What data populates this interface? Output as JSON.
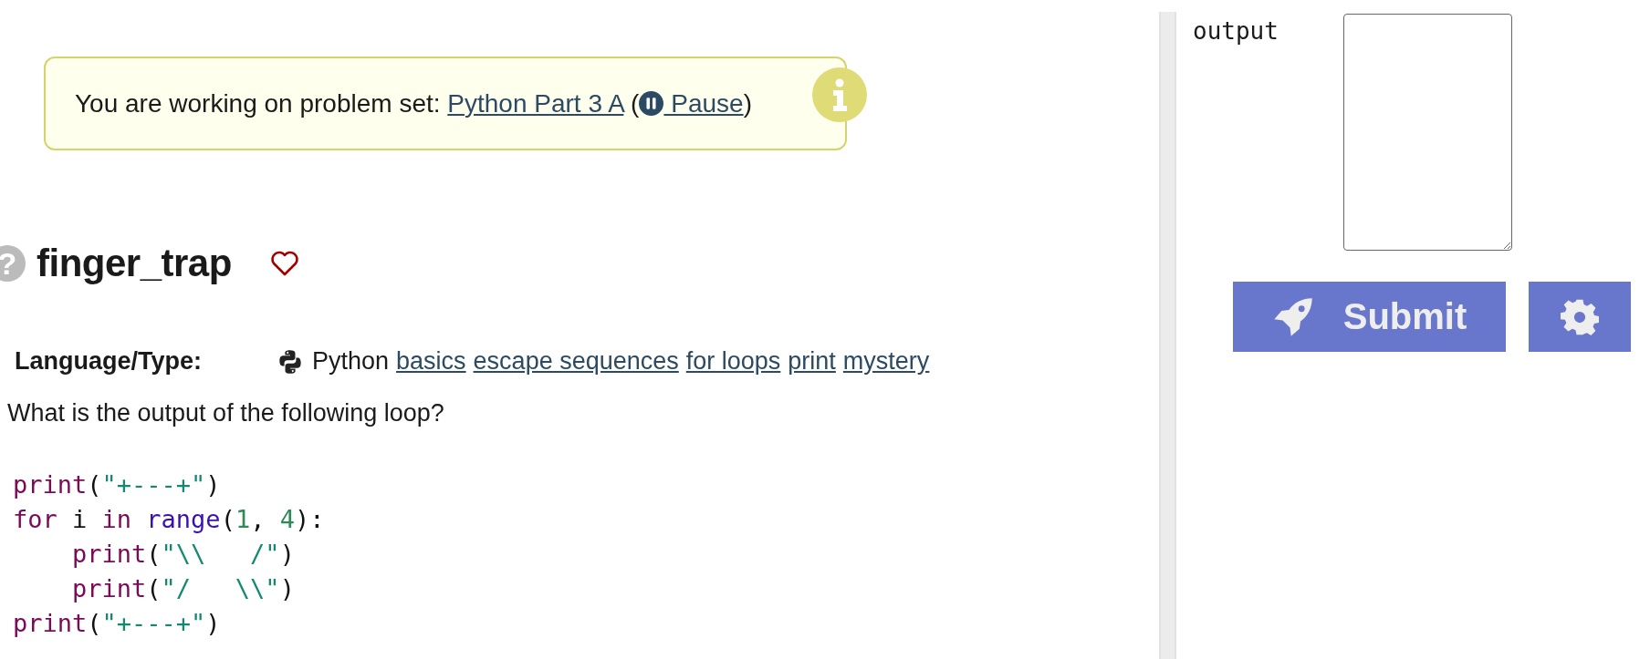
{
  "banner": {
    "prefix": "You are working on problem set: ",
    "set_link": "Python Part 3 A",
    "open_paren": " (",
    "pause_link": " Pause",
    "close_paren": ")"
  },
  "problem": {
    "help_icon": "?",
    "title": "finger_trap",
    "favorite": false
  },
  "language": {
    "label": "Language/Type:",
    "name": "Python",
    "tags": [
      "basics",
      "escape sequences",
      "for loops",
      "print",
      "mystery"
    ]
  },
  "question": "What is the output of the following loop?",
  "code": [
    {
      "tokens": [
        {
          "kind": "keyword",
          "text": "print"
        },
        {
          "kind": "plain",
          "text": "("
        },
        {
          "kind": "string",
          "text": "\"+---+\""
        },
        {
          "kind": "plain",
          "text": ")"
        }
      ]
    },
    {
      "tokens": [
        {
          "kind": "keyword",
          "text": "for"
        },
        {
          "kind": "plain",
          "text": " i "
        },
        {
          "kind": "keyword",
          "text": "in"
        },
        {
          "kind": "builtin",
          "text": " range"
        },
        {
          "kind": "plain",
          "text": "("
        },
        {
          "kind": "number",
          "text": "1"
        },
        {
          "kind": "plain",
          "text": ", "
        },
        {
          "kind": "number",
          "text": "4"
        },
        {
          "kind": "plain",
          "text": "):"
        }
      ]
    },
    {
      "tokens": [
        {
          "kind": "keyword",
          "text": "    print"
        },
        {
          "kind": "plain",
          "text": "("
        },
        {
          "kind": "string",
          "text": "\"\\\\   /\""
        },
        {
          "kind": "plain",
          "text": ")"
        }
      ]
    },
    {
      "tokens": [
        {
          "kind": "keyword",
          "text": "    print"
        },
        {
          "kind": "plain",
          "text": "("
        },
        {
          "kind": "string",
          "text": "\"/   \\\\\""
        },
        {
          "kind": "plain",
          "text": ")"
        }
      ]
    },
    {
      "tokens": [
        {
          "kind": "keyword",
          "text": "print"
        },
        {
          "kind": "plain",
          "text": "("
        },
        {
          "kind": "string",
          "text": "\"+---+\""
        },
        {
          "kind": "plain",
          "text": ")"
        }
      ]
    }
  ],
  "answer": {
    "label": "output",
    "submit": "Submit"
  }
}
